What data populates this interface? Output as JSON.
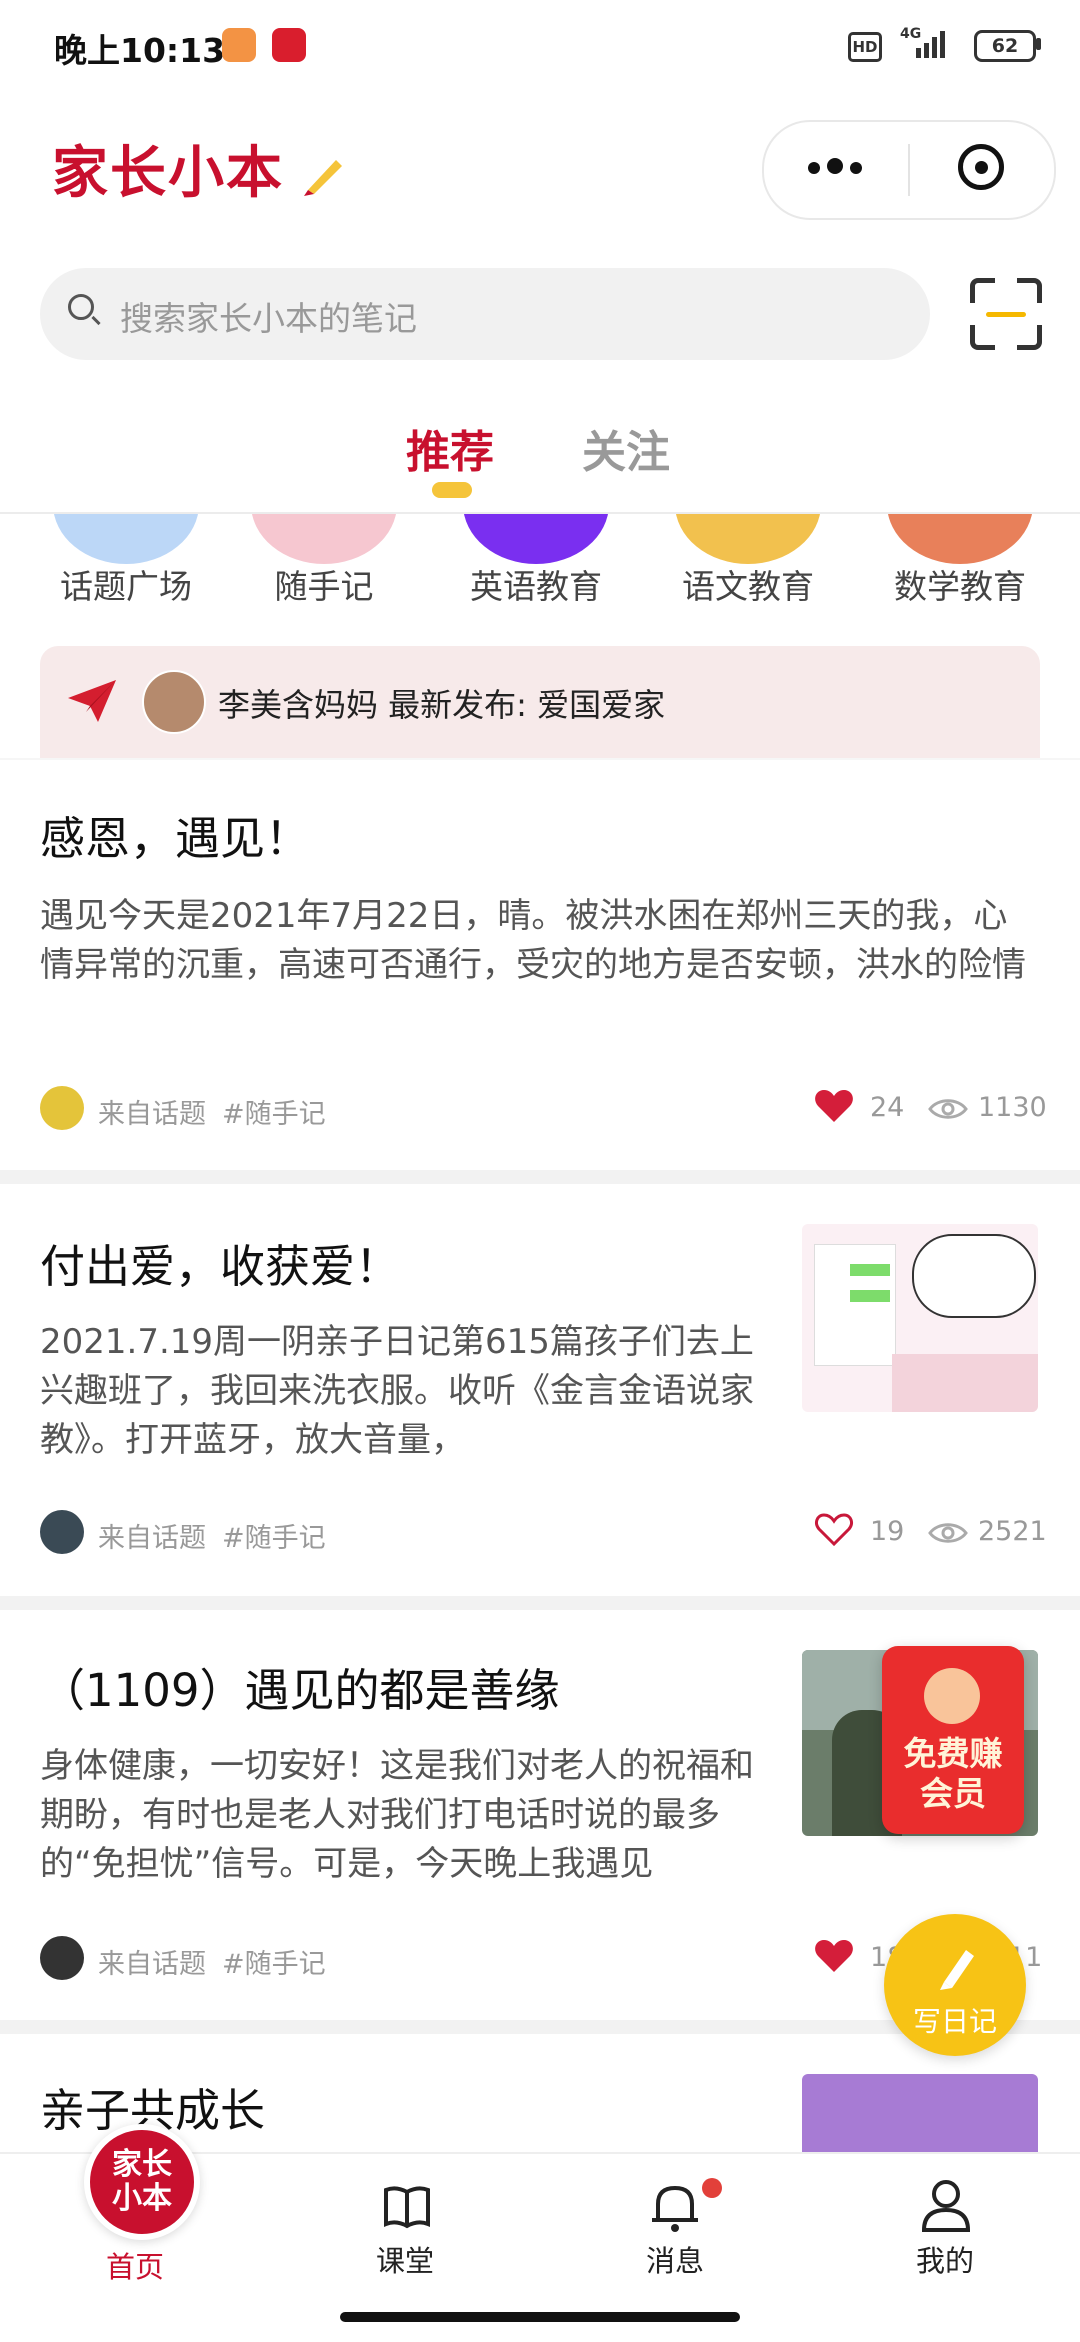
{
  "status_bar": {
    "time": "晚上10:13",
    "network": "4G",
    "hd": "HD",
    "battery": "62"
  },
  "header": {
    "logo": "家长小本"
  },
  "search": {
    "placeholder": "搜索家长小本的笔记"
  },
  "tabs": [
    {
      "label": "推荐",
      "active": true
    },
    {
      "label": "关注",
      "active": false
    }
  ],
  "categories": [
    {
      "label": "话题广场",
      "color": "#bcd7f7"
    },
    {
      "label": "随手记",
      "color": "#f6c7d0"
    },
    {
      "label": "英语教育",
      "color": "#7a2ff0"
    },
    {
      "label": "语文教育",
      "color": "#f2c14e"
    },
    {
      "label": "数学教育",
      "color": "#e8805a"
    }
  ],
  "notice": {
    "text": "李美含妈妈 最新发布: 爱国爱家"
  },
  "posts": [
    {
      "title": "感恩，遇见！",
      "body": "遇见今天是2021年7月22日，晴。被洪水困在郑州三天的我，心情异常的沉重，高速可否通行，受灾的地方是否安顿，洪水的险情",
      "source": "来自话题",
      "topic": "#随手记",
      "likes": "24",
      "views": "1130",
      "liked": true
    },
    {
      "title": "付出爱，收获爱！",
      "body": "2021.7.19周一阴亲子日记第615篇孩子们去上兴趣班了，我回来洗衣服。收听《金言金语说家教》。打开蓝牙，放大音量，",
      "source": "来自话题",
      "topic": "#随手记",
      "likes": "19",
      "views": "2521",
      "liked": false
    },
    {
      "title": "（1109）遇见的都是善缘",
      "body": "身体健康，一切安好！这是我们对老人的祝福和期盼，有时也是老人对我们打电话时说的最多的“免担忧”信号。可是，今天晚上我遇见",
      "source": "来自话题",
      "topic": "#随手记",
      "likes": "18",
      "views": "11",
      "liked": true
    },
    {
      "title": "亲子共成长"
    }
  ],
  "floating": {
    "redpacket": "免费赚\n会员",
    "write": "写日记"
  },
  "bottom_nav": [
    {
      "label": "首页",
      "icon": "home-logo-icon",
      "active": true,
      "home_badge": "家长\n小本"
    },
    {
      "label": "课堂",
      "icon": "book-icon"
    },
    {
      "label": "消息",
      "icon": "bell-icon"
    },
    {
      "label": "我的",
      "icon": "user-icon"
    }
  ],
  "colors": {
    "brand": "#c8102e",
    "accent": "#f7c315",
    "muted": "#999999"
  }
}
